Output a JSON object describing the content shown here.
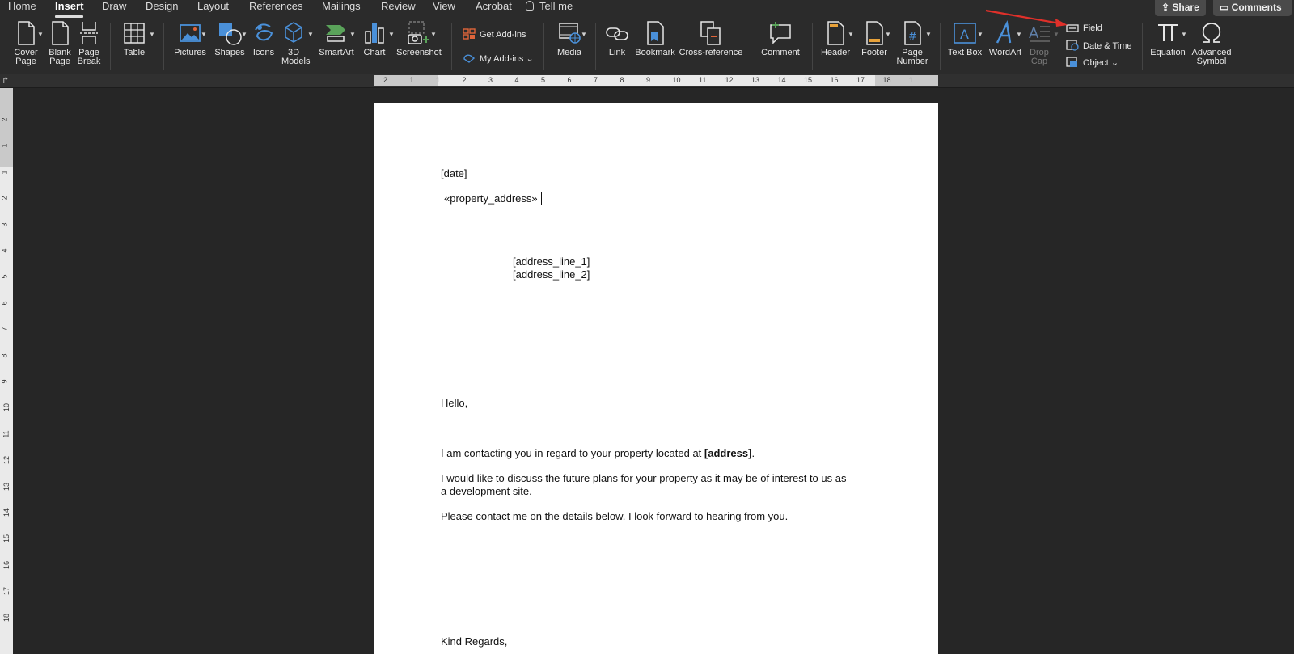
{
  "tabs": [
    {
      "label": "Home",
      "active": false
    },
    {
      "label": "Insert",
      "active": true
    },
    {
      "label": "Draw",
      "active": false
    },
    {
      "label": "Design",
      "active": false
    },
    {
      "label": "Layout",
      "active": false
    },
    {
      "label": "References",
      "active": false
    },
    {
      "label": "Mailings",
      "active": false
    },
    {
      "label": "Review",
      "active": false
    },
    {
      "label": "View",
      "active": false
    },
    {
      "label": "Acrobat",
      "active": false
    }
  ],
  "tell_me": "Tell me",
  "share_label": "Share",
  "comments_label": "Comments",
  "ribbon": {
    "cover_page": [
      "Cover",
      "Page"
    ],
    "blank_page": [
      "Blank",
      "Page"
    ],
    "page_break": [
      "Page",
      "Break"
    ],
    "table": "Table",
    "pictures": "Pictures",
    "shapes": "Shapes",
    "icons": "Icons",
    "models_3d": [
      "3D",
      "Models"
    ],
    "smartart": "SmartArt",
    "chart": "Chart",
    "screenshot": "Screenshot",
    "get_addins": "Get Add-ins",
    "my_addins": "My Add-ins",
    "media": "Media",
    "link": "Link",
    "bookmark": "Bookmark",
    "cross_reference": "Cross-reference",
    "comment": "Comment",
    "header": "Header",
    "footer": "Footer",
    "page_number": [
      "Page",
      "Number"
    ],
    "text_box": "Text Box",
    "wordart": "WordArt",
    "drop_cap": [
      "Drop",
      "Cap"
    ],
    "field": "Field",
    "date_time": "Date & Time",
    "object": "Object",
    "equation": "Equation",
    "advanced_symbol": [
      "Advanced",
      "Symbol"
    ],
    "colors": {
      "accent_blue": "#4a90d9",
      "addin_orange": "#e0653a",
      "green": "#5aa35a",
      "arrow_red": "#e0302a"
    }
  },
  "ruler": {
    "h_labels": [
      "2",
      "1",
      "1",
      "2",
      "3",
      "4",
      "5",
      "6",
      "7",
      "8",
      "9",
      "10",
      "11",
      "12",
      "13",
      "14",
      "15",
      "16",
      "17",
      "18",
      "1"
    ],
    "v_labels": [
      "2",
      "1",
      "1",
      "2",
      "3",
      "4",
      "5",
      "6",
      "7",
      "8",
      "9",
      "10",
      "11",
      "12",
      "13",
      "14",
      "15",
      "16",
      "17",
      "18"
    ]
  },
  "document": {
    "date": "[date]",
    "property_address": "«property_address»",
    "address_line_1": "[address_line_1]",
    "address_line_2": "[address_line_2]",
    "greeting": "Hello,",
    "para1_prefix": "I am contacting you in regard to your property located at ",
    "para1_bold": "[address]",
    "para1_suffix": ".",
    "para2_line1": "I would like to discuss the future plans for your property as it may be of interest to us as",
    "para2_line2": "a development site.",
    "para3": "Please contact me on the details below. I look forward to hearing from you.",
    "closing": "Kind Regards,"
  }
}
